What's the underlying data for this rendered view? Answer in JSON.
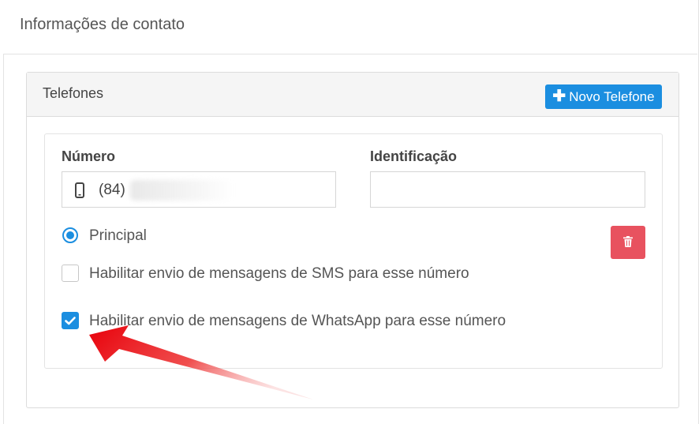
{
  "section": {
    "title": "Informações de contato"
  },
  "phones": {
    "title": "Telefones",
    "new_button_label": "Novo Telefone",
    "number_label": "Número",
    "number_prefix": "(84)",
    "identification_label": "Identificação",
    "identification_value": "",
    "principal_label": "Principal",
    "principal_selected": true,
    "sms_label": "Habilitar envio de mensagens de SMS para esse número",
    "sms_checked": false,
    "whatsapp_label": "Habilitar envio de mensagens de WhatsApp para esse número",
    "whatsapp_checked": true
  },
  "colors": {
    "accent": "#1b8ee0",
    "danger": "#e8525f",
    "arrow": "#e8000a"
  },
  "icons": {
    "plus": "plus-icon",
    "phone": "mobile-phone-icon",
    "delete": "trash-icon",
    "check": "check-icon"
  }
}
